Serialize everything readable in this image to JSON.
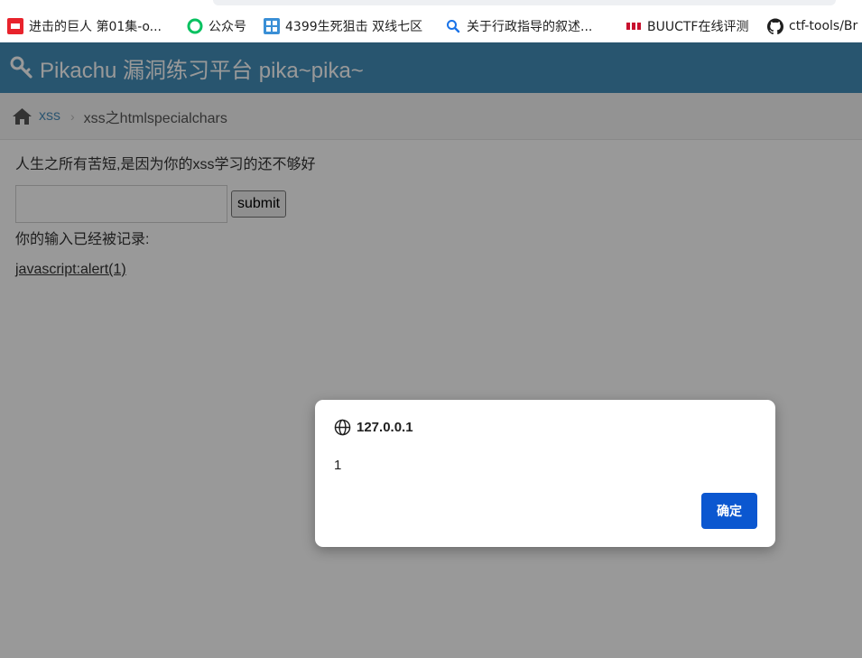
{
  "bookmarks": [
    {
      "label": "进击的巨人 第01集-o...",
      "icon": "iqiyi-icon"
    },
    {
      "label": "公众号",
      "icon": "wechat-icon"
    },
    {
      "label": "4399生死狙击 双线七区",
      "icon": "4399-icon"
    },
    {
      "label": "关于行政指导的叙述...",
      "icon": "search-icon"
    },
    {
      "label": "BUUCTF在线评测",
      "icon": "buuctf-icon"
    },
    {
      "label": "ctf-tools/Br",
      "icon": "github-icon"
    }
  ],
  "header": {
    "brand": "Pikachu 漏洞练习平台 pika~pika~"
  },
  "breadcrumb": {
    "link": "xss",
    "current": "xss之htmlspecialchars"
  },
  "main": {
    "tip": "人生之所有苦短,是因为你的xss学习的还不够好",
    "input_value": "",
    "submit_label": "submit",
    "record_label": "你的输入已经被记录:",
    "record_link": "javascript:alert(1)"
  },
  "dialog": {
    "origin": "127.0.0.1",
    "message": "1",
    "ok_label": "确定"
  },
  "colors": {
    "navbar": "#438eb9",
    "ok_button": "#0b57d0"
  }
}
